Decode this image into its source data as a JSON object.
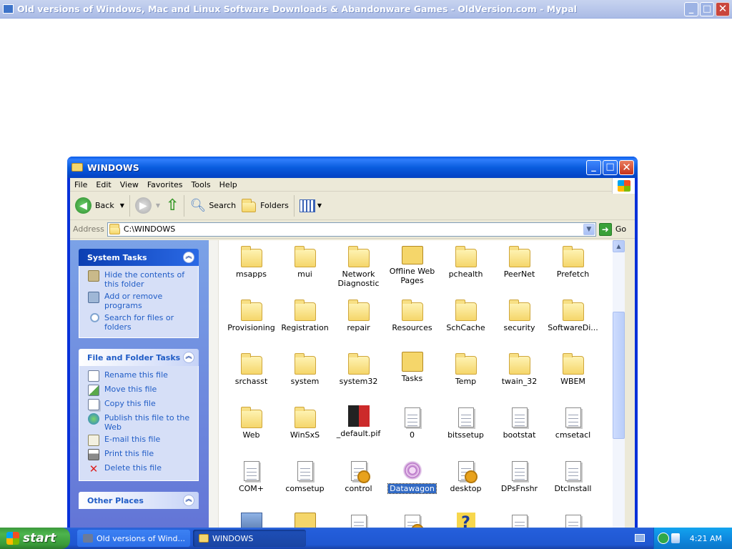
{
  "browser": {
    "title": "Old versions of Windows, Mac and Linux Software Downloads & Abandonware Games - OldVersion.com - Mypal",
    "min": "_",
    "max": "□",
    "close": "✕"
  },
  "explorer": {
    "title": "WINDOWS",
    "menu": [
      "File",
      "Edit",
      "View",
      "Favorites",
      "Tools",
      "Help"
    ],
    "toolbar": {
      "back": "Back",
      "search": "Search",
      "folders": "Folders"
    },
    "address": {
      "label": "Address",
      "value": "C:\\WINDOWS",
      "go": "Go"
    },
    "system_tasks": {
      "title": "System Tasks",
      "items": [
        "Hide the contents of this folder",
        "Add or remove programs",
        "Search for files or folders"
      ]
    },
    "file_tasks": {
      "title": "File and Folder Tasks",
      "items": [
        "Rename this file",
        "Move this file",
        "Copy this file",
        "Publish this file to the Web",
        "E-mail this file",
        "Print this file",
        "Delete this file"
      ]
    },
    "other_places": {
      "title": "Other Places"
    },
    "files": [
      {
        "name": "msapps",
        "icon": "folder-icon"
      },
      {
        "name": "mui",
        "icon": "folder-icon"
      },
      {
        "name": "Network Diagnostic",
        "icon": "folder-icon"
      },
      {
        "name": "Offline Web Pages",
        "icon": "offline-folder-icon"
      },
      {
        "name": "pchealth",
        "icon": "folder-icon"
      },
      {
        "name": "PeerNet",
        "icon": "folder-icon"
      },
      {
        "name": "Prefetch",
        "icon": "folder-icon"
      },
      {
        "name": "Provisioning",
        "icon": "folder-icon"
      },
      {
        "name": "Registration",
        "icon": "folder-icon"
      },
      {
        "name": "repair",
        "icon": "folder-icon"
      },
      {
        "name": "Resources",
        "icon": "folder-icon"
      },
      {
        "name": "SchCache",
        "icon": "folder-icon"
      },
      {
        "name": "security",
        "icon": "folder-icon"
      },
      {
        "name": "SoftwareDi...",
        "icon": "folder-icon"
      },
      {
        "name": "srchasst",
        "icon": "folder-icon"
      },
      {
        "name": "system",
        "icon": "folder-icon"
      },
      {
        "name": "system32",
        "icon": "folder-icon"
      },
      {
        "name": "Tasks",
        "icon": "tasks-folder-icon"
      },
      {
        "name": "Temp",
        "icon": "folder-icon"
      },
      {
        "name": "twain_32",
        "icon": "folder-icon"
      },
      {
        "name": "WBEM",
        "icon": "folder-icon"
      },
      {
        "name": "Web",
        "icon": "folder-icon"
      },
      {
        "name": "WinSxS",
        "icon": "folder-icon"
      },
      {
        "name": "_default.pif",
        "icon": "msdos-icon"
      },
      {
        "name": "0",
        "icon": "text-file-icon"
      },
      {
        "name": "bitssetup",
        "icon": "text-file-icon"
      },
      {
        "name": "bootstat",
        "icon": "dat-file-icon"
      },
      {
        "name": "cmsetacl",
        "icon": "text-file-icon"
      },
      {
        "name": "COM+",
        "icon": "text-file-icon"
      },
      {
        "name": "comsetup",
        "icon": "text-file-icon"
      },
      {
        "name": "control",
        "icon": "settings-file-icon"
      },
      {
        "name": "Datawagon",
        "icon": "datawagon-icon"
      },
      {
        "name": "desktop",
        "icon": "settings-file-icon"
      },
      {
        "name": "DPsFnshr",
        "icon": "text-file-icon"
      },
      {
        "name": "DtcInstall",
        "icon": "text-file-icon"
      },
      {
        "name": "",
        "icon": "computer-icon"
      },
      {
        "name": "",
        "icon": "search-folder-icon"
      },
      {
        "name": "",
        "icon": "text-file-icon"
      },
      {
        "name": "",
        "icon": "settings-file-icon"
      },
      {
        "name": "",
        "icon": "help-icon"
      },
      {
        "name": "",
        "icon": "text-file-icon"
      },
      {
        "name": "",
        "icon": "text-file-icon"
      }
    ],
    "selected": "Datawagon"
  },
  "taskbar": {
    "start": "start",
    "tasks": [
      {
        "label": "Old versions of Wind...",
        "active": false
      },
      {
        "label": "WINDOWS",
        "active": true
      }
    ],
    "clock": "4:21 AM"
  },
  "colors": {
    "xp_blue": "#0831d9",
    "selection": "#316ac5",
    "task_link": "#215dc6",
    "start_green": "#3c9a3c"
  }
}
